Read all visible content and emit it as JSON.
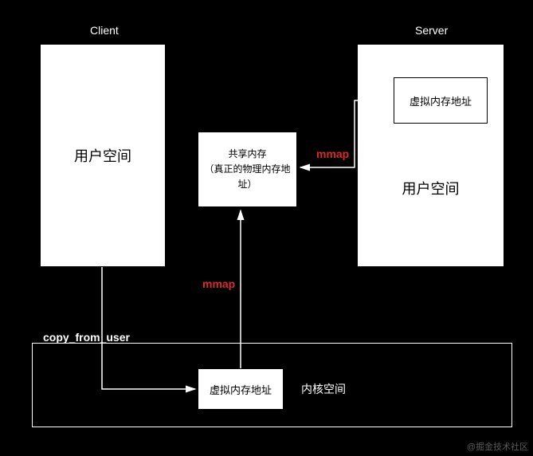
{
  "labels": {
    "client": "Client",
    "server": "Server",
    "userSpaceClient": "用户空间",
    "userSpaceServer": "用户空间",
    "virtualMemServer": "虚拟内存地址",
    "sharedMem": "共享内存\n（真正的物理内存地址）",
    "virtualMemKernel": "虚拟内存地址",
    "kernelSpace": "内核空间",
    "mmap1": "mmap",
    "mmap2": "mmap",
    "copyFromUser": "copy_from_user",
    "watermark": "@掘金技术社区"
  },
  "chart_data": {
    "type": "diagram",
    "title": "Shared Memory IPC via mmap",
    "nodes": [
      {
        "id": "client-user-space",
        "label": "用户空间",
        "group": "Client"
      },
      {
        "id": "server-user-space",
        "label": "用户空间",
        "group": "Server"
      },
      {
        "id": "server-vmem",
        "label": "虚拟内存地址",
        "group": "Server"
      },
      {
        "id": "shared-mem",
        "label": "共享内存（真正的物理内存地址）"
      },
      {
        "id": "kernel-vmem",
        "label": "虚拟内存地址",
        "group": "内核空间"
      },
      {
        "id": "kernel-space",
        "label": "内核空间"
      }
    ],
    "edges": [
      {
        "from": "client-user-space",
        "to": "kernel-vmem",
        "label": "copy_from_user"
      },
      {
        "from": "kernel-vmem",
        "to": "shared-mem",
        "label": "mmap"
      },
      {
        "from": "server-vmem",
        "to": "shared-mem",
        "label": "mmap"
      }
    ]
  }
}
